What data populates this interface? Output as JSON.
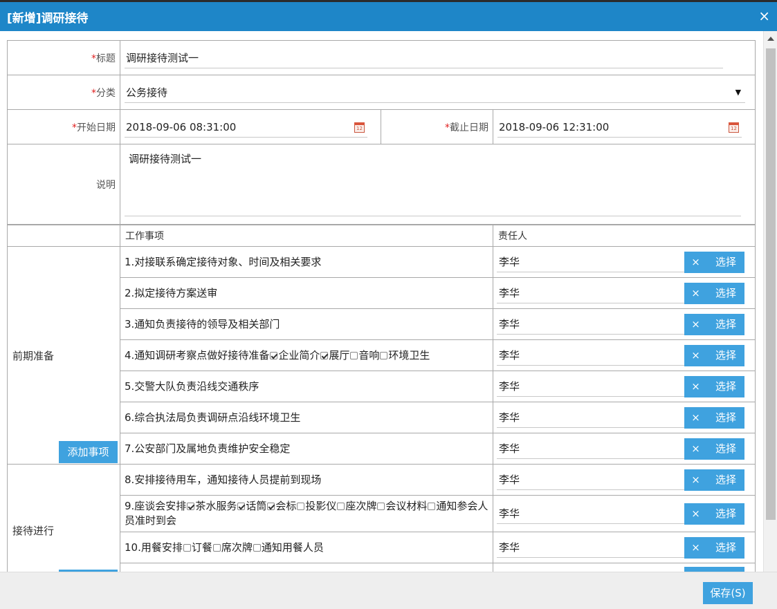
{
  "dialog": {
    "title": "[新增]调研接待",
    "close": "×"
  },
  "form": {
    "required_mark": "*",
    "title_label": "标题",
    "title_value": "调研接待测试一",
    "category_label": "分类",
    "category_value": "公务接待",
    "category_arrow": "▼",
    "start_label": "开始日期",
    "start_value": "2018-09-06 08:31:00",
    "end_label": "截止日期",
    "end_value": "2018-09-06 12:31:00",
    "desc_label": "说明",
    "desc_value": "调研接待测试一"
  },
  "tasks": {
    "col_work": "工作事项",
    "col_responsible": "责任人",
    "clear_label": "×",
    "select_label": "选择",
    "add_label": "添加事项",
    "groups": [
      {
        "label": "前期准备",
        "rows": [
          {
            "text": "1.对接联系确定接待对象、时间及相关要求",
            "person": "李华"
          },
          {
            "text": "2.拟定接待方案送审",
            "person": "李华"
          },
          {
            "text": "3.通知负责接待的领导及相关部门",
            "person": "李华"
          },
          {
            "prefix": "4.通知调研考察点做好接待准备",
            "options": [
              {
                "label": "企业简介",
                "checked": true
              },
              {
                "label": "展厅",
                "checked": true
              },
              {
                "label": "音响",
                "checked": false
              },
              {
                "label": "环境卫生",
                "checked": false
              }
            ],
            "person": "李华"
          },
          {
            "text": "5.交警大队负责沿线交通秩序",
            "person": "李华"
          },
          {
            "text": "6.综合执法局负责调研点沿线环境卫生",
            "person": "李华"
          },
          {
            "text": "7.公安部门及属地负责维护安全稳定",
            "person": "李华"
          }
        ]
      },
      {
        "label": "接待进行",
        "rows": [
          {
            "text": "8.安排接待用车，通知接待人员提前到现场",
            "person": "李华"
          },
          {
            "prefix": "9.座谈会安排",
            "options": [
              {
                "label": "茶水服务",
                "checked": true
              },
              {
                "label": "话筒",
                "checked": true
              },
              {
                "label": "会标",
                "checked": true
              },
              {
                "label": "投影仪",
                "checked": false
              },
              {
                "label": "座次牌",
                "checked": false
              },
              {
                "label": "会议材料",
                "checked": false
              },
              {
                "label": "通知参会人员准时到会",
                "checked": false
              }
            ],
            "person": "李华"
          },
          {
            "prefix": "10.用餐安排",
            "options": [
              {
                "label": "订餐",
                "checked": false
              },
              {
                "label": "席次牌",
                "checked": false
              },
              {
                "label": "通知用餐人员",
                "checked": false
              }
            ],
            "person": "李华"
          }
        ]
      }
    ]
  },
  "footer": {
    "save_label": "保存(S)"
  }
}
